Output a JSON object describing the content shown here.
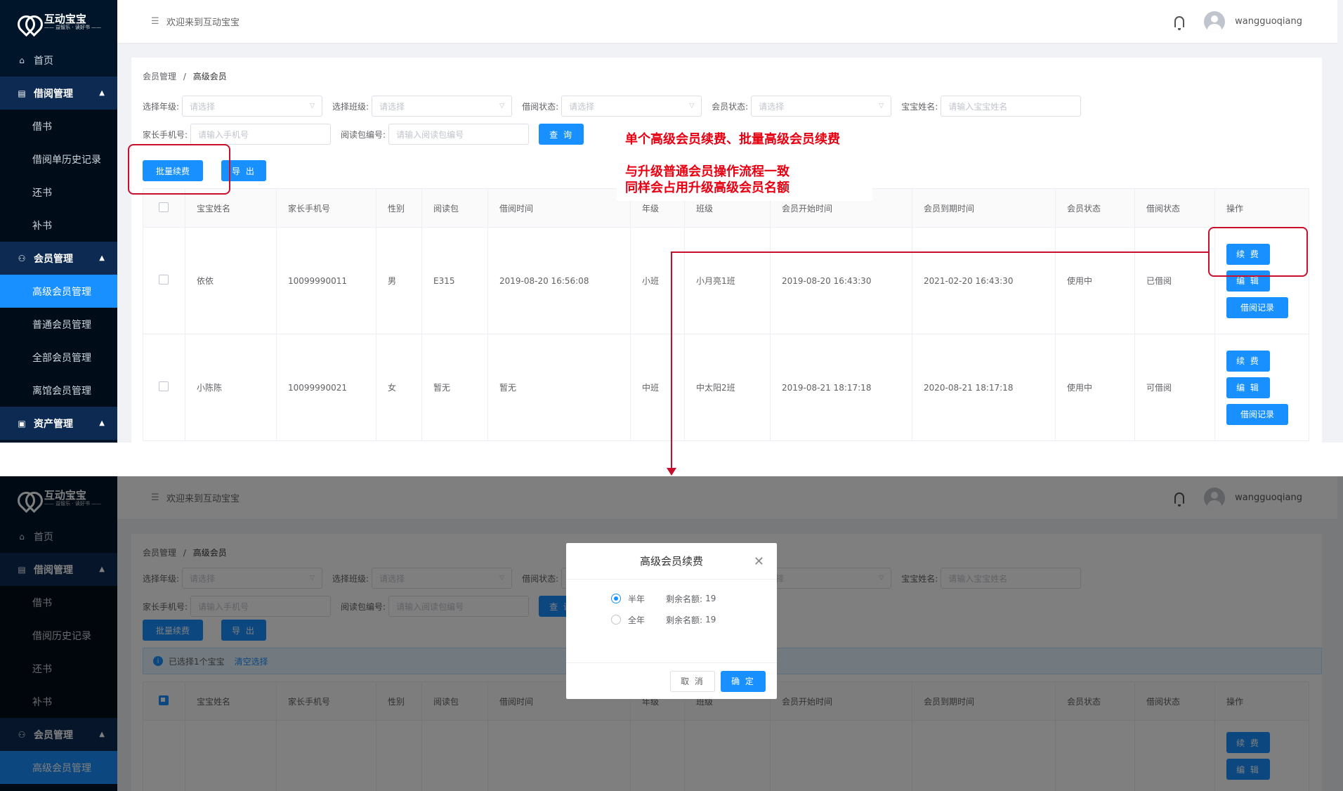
{
  "app": {
    "logo_title": "互动宝宝",
    "logo_subtitle": "—— 益智乐 · 读好书 ——",
    "welcome": "欢迎来到互动宝宝",
    "username": "wangguoqiang"
  },
  "sidebar": {
    "items": [
      {
        "label": "首页"
      },
      {
        "label": "借阅管理"
      },
      {
        "label": "借书"
      },
      {
        "label": "借阅单历史记录"
      },
      {
        "label": "还书"
      },
      {
        "label": "补书"
      },
      {
        "label": "会员管理"
      },
      {
        "label": "高级会员管理"
      },
      {
        "label": "普通会员管理"
      },
      {
        "label": "全部会员管理"
      },
      {
        "label": "离馆会员管理"
      },
      {
        "label": "资产管理"
      }
    ],
    "items2": [
      {
        "label": "首页"
      },
      {
        "label": "借阅管理"
      },
      {
        "label": "借书"
      },
      {
        "label": "借阅历史记录"
      },
      {
        "label": "还书"
      },
      {
        "label": "补书"
      },
      {
        "label": "会员管理"
      },
      {
        "label": "高级会员管理"
      }
    ]
  },
  "breadcrumb": {
    "parent": "会员管理",
    "sep": "/",
    "current": "高级会员"
  },
  "filters": {
    "grade_label": "选择年级:",
    "class_label": "选择班级:",
    "borrow_status_label": "借阅状态:",
    "member_status_label": "会员状态:",
    "baby_name_label": "宝宝姓名:",
    "phone_label": "家长手机号:",
    "pack_label": "阅读包编号:",
    "select_placeholder": "请选择",
    "name_placeholder": "请输入宝宝姓名",
    "phone_placeholder": "请输入手机号",
    "pack_placeholder": "请输入阅读包编号",
    "query_button": "查 询"
  },
  "actions": {
    "batch_renew": "批量续费",
    "export": "导 出"
  },
  "table": {
    "headers": [
      "宝宝姓名",
      "家长手机号",
      "性别",
      "阅读包",
      "借阅时间",
      "年级",
      "班级",
      "会员开始时间",
      "会员到期时间",
      "会员状态",
      "借阅状态",
      "操作"
    ],
    "rows": [
      {
        "name": "依依",
        "phone": "10099990011",
        "gender": "男",
        "pack": "E315",
        "borrow_time": "2019-08-20 16:56:08",
        "grade": "小班",
        "class": "小月亮1班",
        "start": "2019-08-20 16:43:30",
        "end": "2021-02-20 16:43:30",
        "member_status": "使用中",
        "borrow_status": "已借阅"
      },
      {
        "name": "小陈陈",
        "phone": "10099990021",
        "gender": "女",
        "pack": "暂无",
        "borrow_time": "暂无",
        "grade": "中班",
        "class": "中太阳2班",
        "start": "2019-08-21 18:17:18",
        "end": "2020-08-21 18:17:18",
        "member_status": "使用中",
        "borrow_status": "可借阅"
      }
    ],
    "op_renew": "续 费",
    "op_edit": "编 辑",
    "op_history": "借阅记录"
  },
  "annotations": {
    "line1": "单个高级会员续费、批量高级会员续费",
    "line2": "与升级普通会员操作流程一致",
    "line3": "同样会占用升级高级会员名额"
  },
  "selection_bar": {
    "text": "已选择1个宝宝",
    "clear": "清空选择"
  },
  "dialog": {
    "title": "高级会员续费",
    "options": [
      {
        "label": "半年",
        "remaining_label": "剩余名额:",
        "remaining": "19",
        "selected": true
      },
      {
        "label": "全年",
        "remaining_label": "剩余名额:",
        "remaining": "19",
        "selected": false
      }
    ],
    "cancel": "取 消",
    "ok": "确 定"
  },
  "colors": {
    "primary": "#1890ff",
    "sidebar": "#001529",
    "annotation": "#e60012"
  }
}
